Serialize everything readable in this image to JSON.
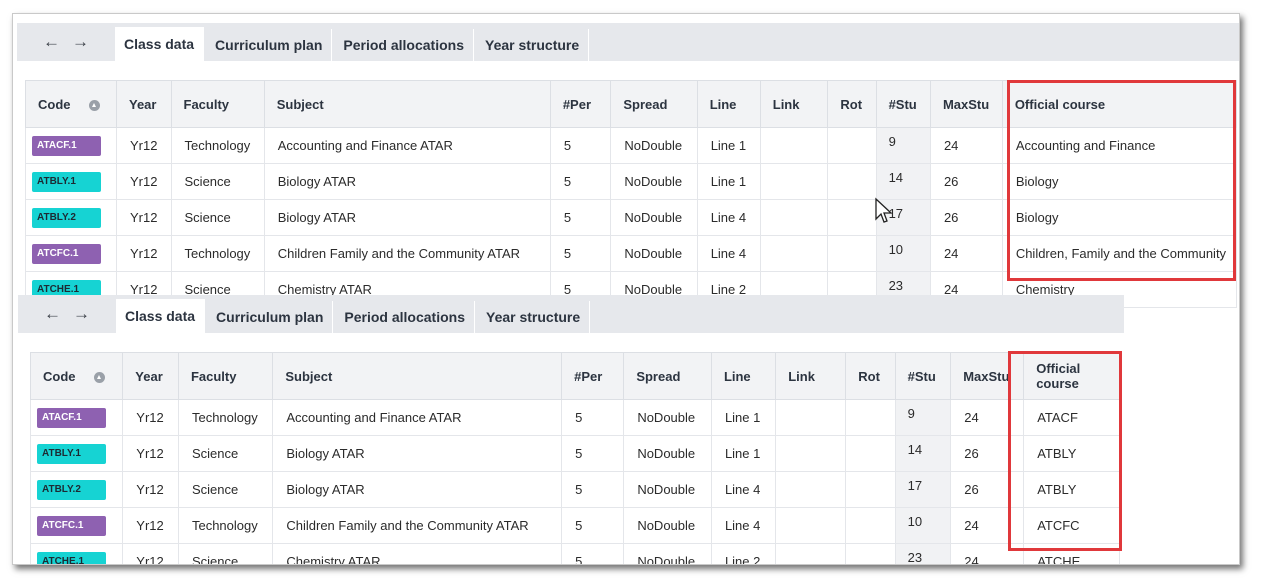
{
  "nav": {
    "back_icon": "←",
    "forward_icon": "→"
  },
  "tabs": [
    "Class data",
    "Curriculum plan",
    "Period allocations",
    "Year structure"
  ],
  "columns": [
    "Code",
    "Year",
    "Faculty",
    "Subject",
    "#Per",
    "Spread",
    "Line",
    "Link",
    "Rot",
    "#Stu",
    "MaxStu",
    "Official course"
  ],
  "rows": [
    {
      "code": "ATACF.1",
      "code_color": "purple",
      "year": "Yr12",
      "faculty": "Technology",
      "subject": "Accounting and Finance ATAR",
      "per": "5",
      "spread": "NoDouble",
      "line": "Line 1",
      "link": "",
      "rot": "",
      "stu": "9",
      "maxstu": "24"
    },
    {
      "code": "ATBLY.1",
      "code_color": "cyan",
      "year": "Yr12",
      "faculty": "Science",
      "subject": "Biology ATAR",
      "per": "5",
      "spread": "NoDouble",
      "line": "Line 1",
      "link": "",
      "rot": "",
      "stu": "14",
      "maxstu": "26"
    },
    {
      "code": "ATBLY.2",
      "code_color": "cyan",
      "year": "Yr12",
      "faculty": "Science",
      "subject": "Biology ATAR",
      "per": "5",
      "spread": "NoDouble",
      "line": "Line 4",
      "link": "",
      "rot": "",
      "stu": "17",
      "maxstu": "26"
    },
    {
      "code": "ATCFC.1",
      "code_color": "purple",
      "year": "Yr12",
      "faculty": "Technology",
      "subject": "Children Family and the Community ATAR",
      "per": "5",
      "spread": "NoDouble",
      "line": "Line 4",
      "link": "",
      "rot": "",
      "stu": "10",
      "maxstu": "24"
    },
    {
      "code": "ATCHE.1",
      "code_color": "cyan",
      "year": "Yr12",
      "faculty": "Science",
      "subject": "Chemistry ATAR",
      "per": "5",
      "spread": "NoDouble",
      "line": "Line 2",
      "link": "",
      "rot": "",
      "stu": "23",
      "maxstu": "24"
    }
  ],
  "official_course_top": [
    "Accounting and Finance",
    "Biology",
    "Biology",
    "Children, Family and the Community",
    "Chemistry"
  ],
  "official_course_bottom": [
    "ATACF",
    "ATBLY",
    "ATBLY",
    "ATCFC",
    "ATCHE"
  ],
  "colors": {
    "purple": "#8e61b1",
    "cyan": "#16d3d3",
    "highlight": "#e0383b",
    "tabbar": "#e6e8ec"
  }
}
